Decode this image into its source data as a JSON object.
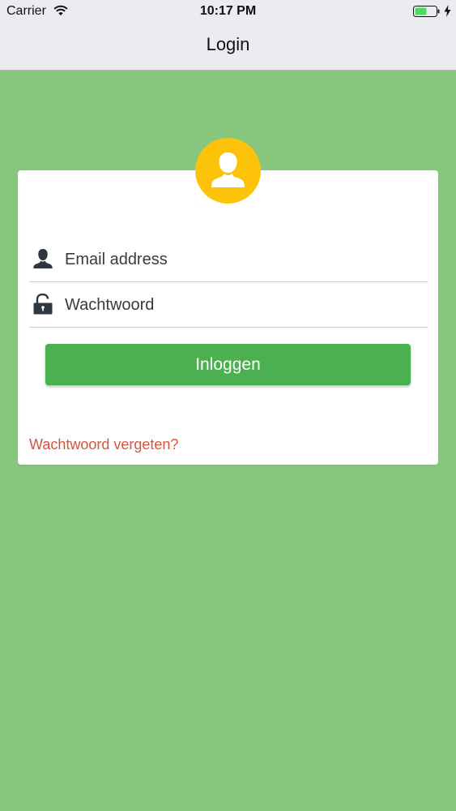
{
  "status_bar": {
    "carrier": "Carrier",
    "time": "10:17 PM",
    "wifi_icon": "wifi-icon",
    "battery_icon": "battery-icon",
    "charging_icon": "charging-bolt-icon"
  },
  "nav": {
    "title": "Login"
  },
  "colors": {
    "background": "#87c77d",
    "nav_background": "#ebebf0",
    "avatar": "#fdc30a",
    "button": "#4caf50",
    "link": "#d9533b"
  },
  "login_form": {
    "avatar_icon": "user-avatar-icon",
    "email": {
      "icon": "user-icon",
      "placeholder": "Email address",
      "value": ""
    },
    "password": {
      "icon": "unlocked-padlock-icon",
      "placeholder": "Wachtwoord",
      "value": ""
    },
    "submit_label": "Inloggen",
    "forgot_password_label": "Wachtwoord vergeten?"
  }
}
